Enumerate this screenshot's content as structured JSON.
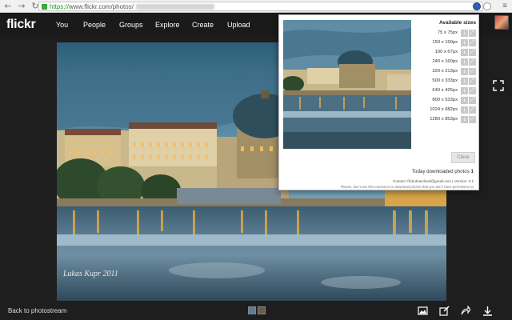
{
  "browser": {
    "url_scheme": "https://",
    "url_path": "www.flickr.com/photos/",
    "back_icon": "back-arrow-icon",
    "forward_icon": "forward-arrow-icon",
    "reload_icon": "reload-icon"
  },
  "topnav": {
    "logo": "flickr",
    "links": [
      "You",
      "People",
      "Groups",
      "Explore",
      "Create",
      "Upload"
    ]
  },
  "bottom": {
    "back_label": "Back to photostream"
  },
  "photo": {
    "watermark": "Lukas Kupr 2011"
  },
  "popup": {
    "title": "Available sizes",
    "sizes": [
      "75 x 75px",
      "150 x 150px",
      "100 x 67px",
      "240 x 160px",
      "320 x 213px",
      "500 x 333px",
      "640 x 426px",
      "800 x 533px",
      "1024 x 682px",
      "1280 x 853px"
    ],
    "close_label": "Close",
    "today_label": "Today downloaded photos",
    "today_count": "1",
    "contact": "Contact: flickrdownload@gmail.com | Version: 0.1",
    "disclaimer": "Please, don't use this extension to download photos that you don't have permission to"
  },
  "colors": {
    "https_green": "#1a9b1a",
    "topbar_bg": "#1a1a1a",
    "popup_button_gray": "#c9c9c9"
  }
}
